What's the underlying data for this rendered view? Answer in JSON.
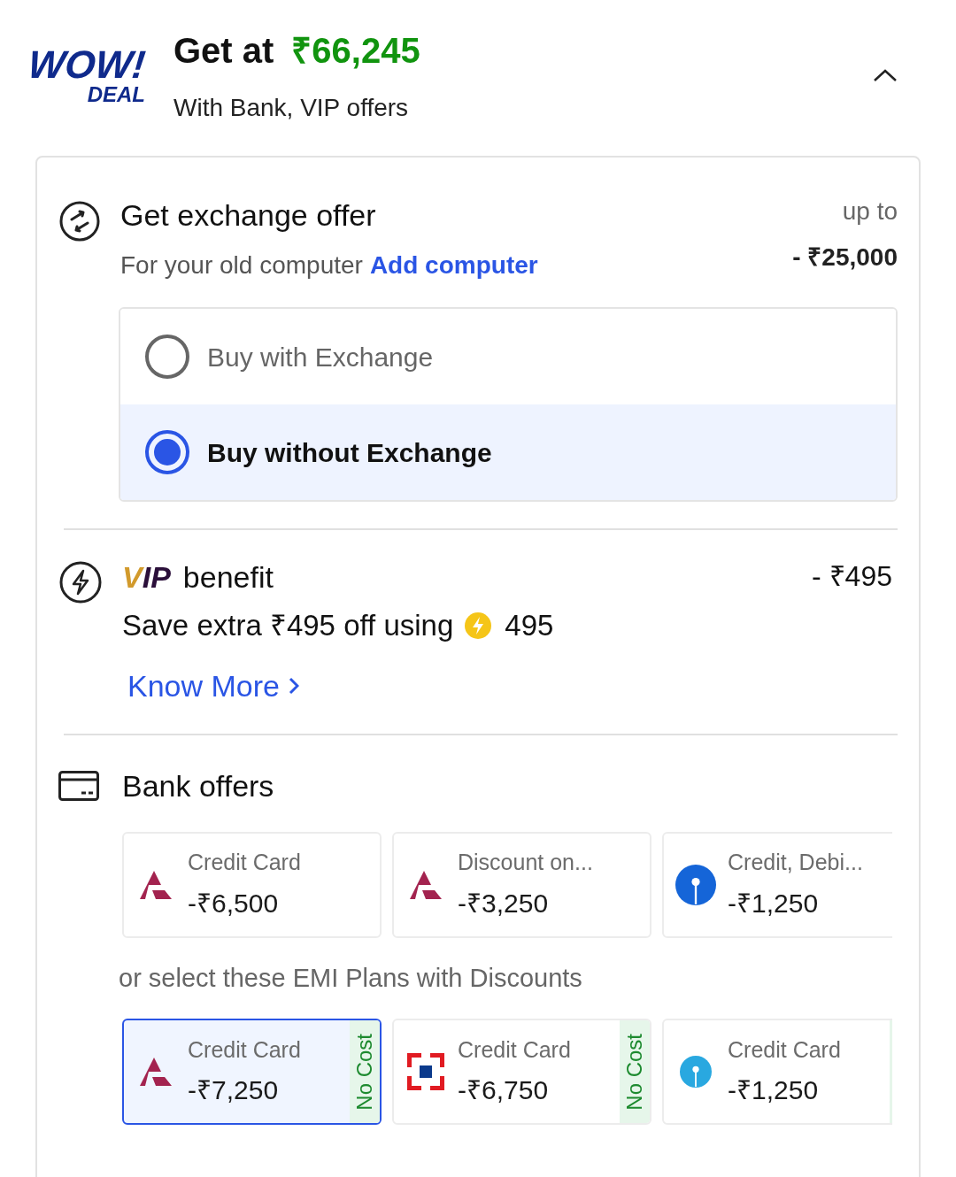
{
  "header": {
    "logo_top": "WOW!",
    "logo_bottom": "DEAL",
    "title": "Get at",
    "price": "₹66,245",
    "subtitle": "With Bank, VIP offers",
    "expanded": true
  },
  "exchange": {
    "title": "Get exchange offer",
    "subtitle": "For your old computer",
    "link": "Add computer",
    "amount_label": "up to",
    "amount": "- ₹25,000",
    "options": [
      {
        "label": "Buy with Exchange",
        "selected": false
      },
      {
        "label": "Buy without Exchange",
        "selected": true
      }
    ]
  },
  "vip": {
    "logo_parts": [
      "V",
      "IP"
    ],
    "title": "benefit",
    "amount": "- ₹495",
    "description": "Save extra ₹495 off using",
    "coins": "495",
    "link": "Know More"
  },
  "bank_offers": {
    "title": "Bank offers",
    "offers": [
      {
        "kind": "triangle",
        "label": "Credit Card",
        "amount": "-₹6,500"
      },
      {
        "kind": "triangle",
        "label": "Discount on...",
        "amount": "-₹3,250"
      },
      {
        "kind": "keyhole",
        "label": "Credit, Debi...",
        "amount": "-₹1,250"
      }
    ],
    "emi_heading": "or select these EMI Plans with Discounts",
    "emi_plans": [
      {
        "kind": "triangle",
        "label": "Credit Card",
        "amount": "-₹7,250",
        "badge": "No Cost",
        "selected": true
      },
      {
        "kind": "frame",
        "label": "Credit Card",
        "amount": "-₹6,750",
        "badge": "No Cost",
        "selected": false
      },
      {
        "kind": "keyhole_light",
        "label": "Credit Card",
        "amount": "-₹1,250",
        "selected": false
      }
    ]
  }
}
